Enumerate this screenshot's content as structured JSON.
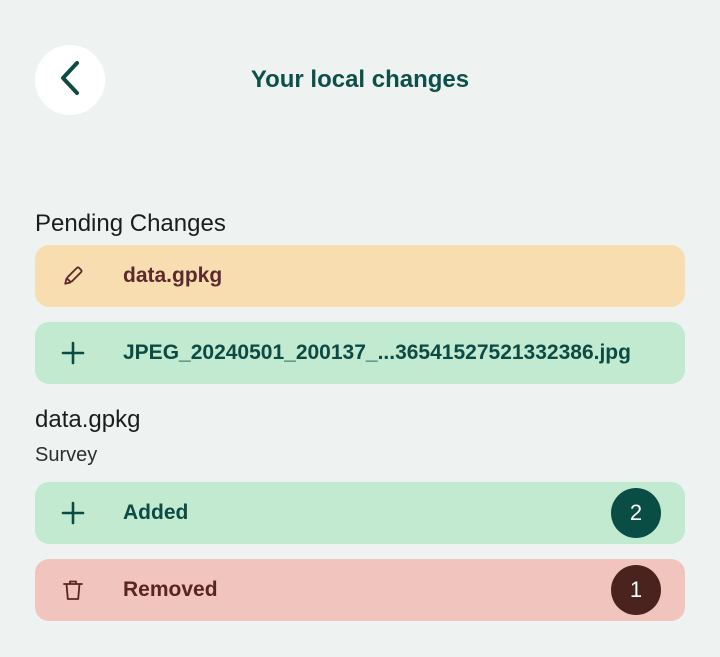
{
  "header": {
    "title": "Your local changes",
    "back_icon": "chevron-left-icon"
  },
  "pending": {
    "section_title": "Pending Changes",
    "items": [
      {
        "icon": "pencil-icon",
        "label": "data.gpkg",
        "status": "modified",
        "color": "#F7DDB0"
      },
      {
        "icon": "plus-icon",
        "label": "JPEG_20240501_200137_...36541527521332386.jpg",
        "status": "added",
        "color": "#C2EAD0"
      }
    ]
  },
  "file_detail": {
    "title": "data.gpkg",
    "subtitle": "Survey",
    "rows": [
      {
        "icon": "plus-icon",
        "label": "Added",
        "count": "2",
        "color": "#C2EAD0",
        "badge_color": "#0A4D45"
      },
      {
        "icon": "trash-icon",
        "label": "Removed",
        "count": "1",
        "color": "#F1C4BD",
        "badge_color": "#4A231F"
      }
    ]
  }
}
